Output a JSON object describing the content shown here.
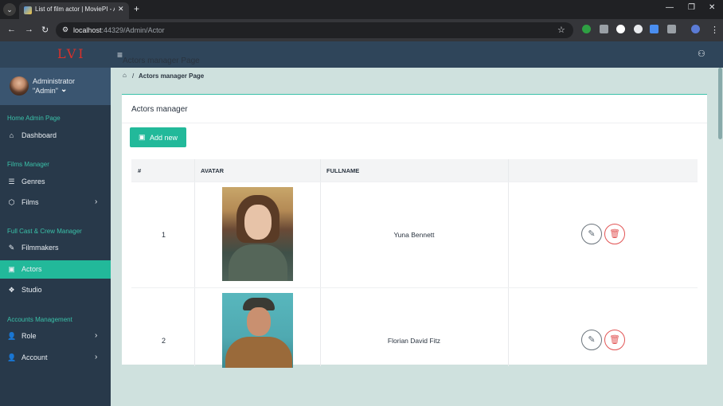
{
  "browser": {
    "tab_title": "List of film actor | MoviePI - Ac",
    "url_host": "localhost",
    "url_rest": ":44329/Admin/Actor"
  },
  "sidebar": {
    "logo": "LVI",
    "user": {
      "name": "Administrator",
      "role": "\"Admin\""
    },
    "sections": [
      {
        "title": "Home Admin Page",
        "items": [
          {
            "label": "Dashboard",
            "icon": "home-icon"
          }
        ]
      },
      {
        "title": "Films Manager",
        "items": [
          {
            "label": "Genres",
            "icon": "list-icon"
          },
          {
            "label": "Films",
            "icon": "cube-icon",
            "has_submenu": true
          }
        ]
      },
      {
        "title": "Full Cast & Crew Manager",
        "items": [
          {
            "label": "Filmmakers",
            "icon": "edit-icon"
          },
          {
            "label": "Actors",
            "icon": "id-card-icon",
            "active": true
          },
          {
            "label": "Studio",
            "icon": "dropbox-icon"
          }
        ]
      },
      {
        "title": "Accounts Management",
        "items": [
          {
            "label": "Role",
            "icon": "user-cog-icon",
            "has_submenu": true
          },
          {
            "label": "Account",
            "icon": "user-icon",
            "has_submenu": true
          }
        ]
      }
    ]
  },
  "page": {
    "title": "Actors manager Page",
    "breadcrumb": "Actors manager Page",
    "card_title": "Actors manager",
    "add_button": "Add new"
  },
  "table": {
    "columns": [
      "#",
      "AVATAR",
      "FULLNAME",
      ""
    ],
    "rows": [
      {
        "num": "1",
        "fullname": "Yuna Bennett"
      },
      {
        "num": "2",
        "fullname": "Florian David Fitz"
      }
    ]
  },
  "colors": {
    "accent": "#22b99a",
    "sidebar_bg": "#28394a",
    "content_bg": "#cfe1de",
    "delete": "#e25555"
  }
}
